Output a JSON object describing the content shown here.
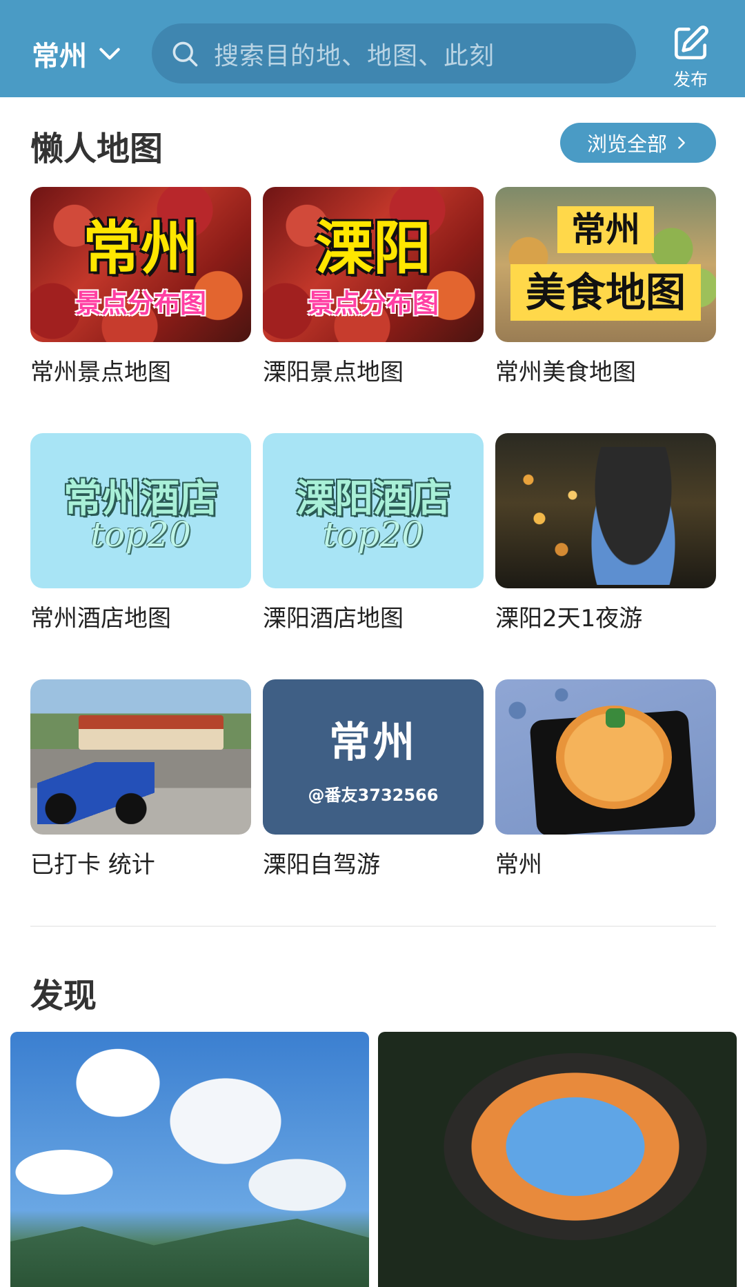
{
  "header": {
    "city": "常州",
    "search_placeholder": "搜索目的地、地图、此刻",
    "publish_label": "发布"
  },
  "lazy_maps": {
    "title": "懒人地图",
    "browse_all": "浏览全部",
    "items": [
      {
        "label": "常州景点地图",
        "thumb_title": "常州",
        "thumb_sub": "景点分布图"
      },
      {
        "label": "溧阳景点地图",
        "thumb_title": "溧阳",
        "thumb_sub": "景点分布图"
      },
      {
        "label": "常州美食地图",
        "thumb_title": "常州",
        "thumb_sub": "美食地图"
      },
      {
        "label": "常州酒店地图",
        "thumb_title": "常州酒店",
        "thumb_sub": "top20"
      },
      {
        "label": "溧阳酒店地图",
        "thumb_title": "溧阳酒店",
        "thumb_sub": "top20"
      },
      {
        "label": "溧阳2天1夜游"
      },
      {
        "label": "已打卡 统计"
      },
      {
        "label": "溧阳自驾游",
        "thumb_title": "常州",
        "thumb_sub": "@番友3732566"
      },
      {
        "label": "常州"
      }
    ]
  },
  "discover": {
    "title": "发现"
  },
  "colors": {
    "header_bg": "#4a9bc5",
    "search_bg": "#3f86b0",
    "accent": "#4a9bc5"
  }
}
